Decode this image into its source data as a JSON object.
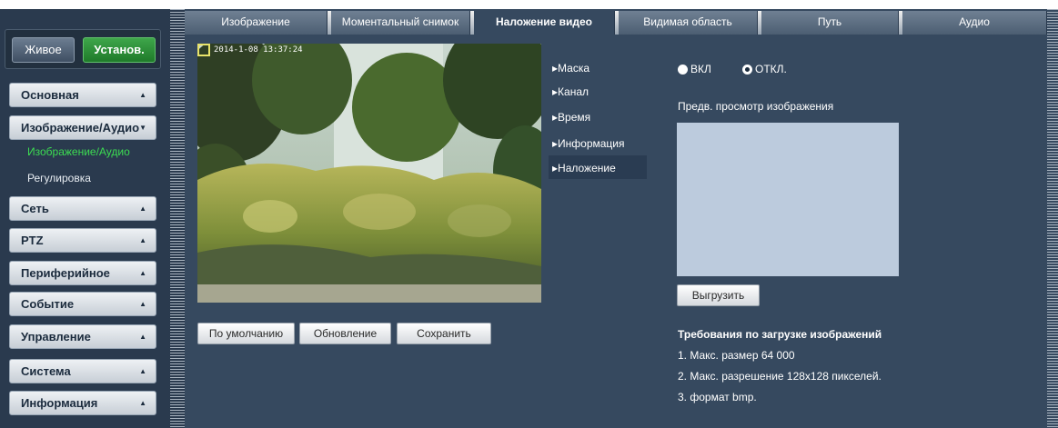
{
  "top_buttons": {
    "live": "Живое",
    "setup": "Установ."
  },
  "sidebar": {
    "menus": [
      {
        "label": "Основная",
        "arrow": "▲"
      },
      {
        "label": "Изображение/Аудио",
        "arrow": "▼"
      },
      {
        "label": "Сеть",
        "arrow": "▲"
      },
      {
        "label": "PTZ",
        "arrow": "▲"
      },
      {
        "label": "Периферийное",
        "arrow": "▲"
      },
      {
        "label": "Событие",
        "arrow": "▲"
      },
      {
        "label": "Управление",
        "arrow": "▲"
      },
      {
        "label": "Система",
        "arrow": "▲"
      },
      {
        "label": "Информация",
        "arrow": "▲"
      }
    ],
    "subitems": [
      {
        "label": "Изображение/Аудио",
        "active": true
      },
      {
        "label": "Регулировка",
        "active": false
      }
    ]
  },
  "tabs": [
    {
      "label": "Изображение",
      "active": false
    },
    {
      "label": "Моментальный снимок",
      "active": false
    },
    {
      "label": "Наложение видео",
      "active": true
    },
    {
      "label": "Видимая область",
      "active": false
    },
    {
      "label": "Путь",
      "active": false
    },
    {
      "label": "Аудио",
      "active": false
    }
  ],
  "preview": {
    "osd_text": "2014-1-08 13:37:24"
  },
  "actions": {
    "default": "По умолчанию",
    "refresh": "Обновление",
    "save": "Сохранить"
  },
  "overlay_menu": [
    {
      "label": "Маска",
      "active": false
    },
    {
      "label": "Канал",
      "active": false
    },
    {
      "label": "Время",
      "active": false
    },
    {
      "label": "Информация",
      "active": false
    },
    {
      "label": "Наложение",
      "active": true
    }
  ],
  "overlay_settings": {
    "on_label": "ВКЛ",
    "off_label": "ОТКЛ.",
    "selected": "off",
    "preview_label": "Предв. просмотр изображения",
    "upload_button": "Выгрузить",
    "requirements_title": "Требования по загрузке изображений",
    "requirements": [
      "1. Макс. размер 64 000",
      "2. Макс. разрешение 128x128 пикселей.",
      "3. формат bmp."
    ]
  },
  "colors": {
    "frame_bg": "#36495f",
    "sidebar_bg": "#2a3a4e",
    "setup_green": "#2f9a3b",
    "active_subitem": "#3cdc52"
  }
}
